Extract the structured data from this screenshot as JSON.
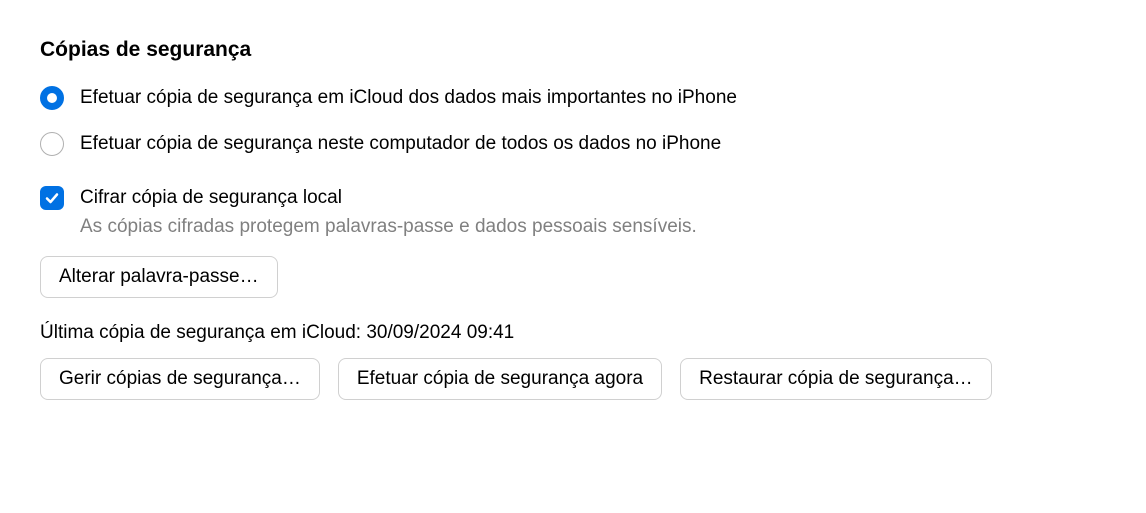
{
  "section": {
    "title": "Cópias de segurança"
  },
  "radios": {
    "icloud": {
      "label": "Efetuar cópia de segurança em iCloud dos dados mais importantes no iPhone",
      "selected": true
    },
    "local": {
      "label": "Efetuar cópia de segurança neste computador de todos os dados no iPhone",
      "selected": false
    }
  },
  "encrypt": {
    "label": "Cifrar cópia de segurança local",
    "hint": "As cópias cifradas protegem palavras-passe e dados pessoais sensíveis.",
    "checked": true
  },
  "buttons": {
    "change_password": "Alterar palavra-passe…",
    "manage": "Gerir cópias de segurança…",
    "backup_now": "Efetuar cópia de segurança agora",
    "restore": "Restaurar cópia de segurança…"
  },
  "last_backup": {
    "text": "Última cópia de segurança em iCloud: 30/09/2024 09:41"
  }
}
